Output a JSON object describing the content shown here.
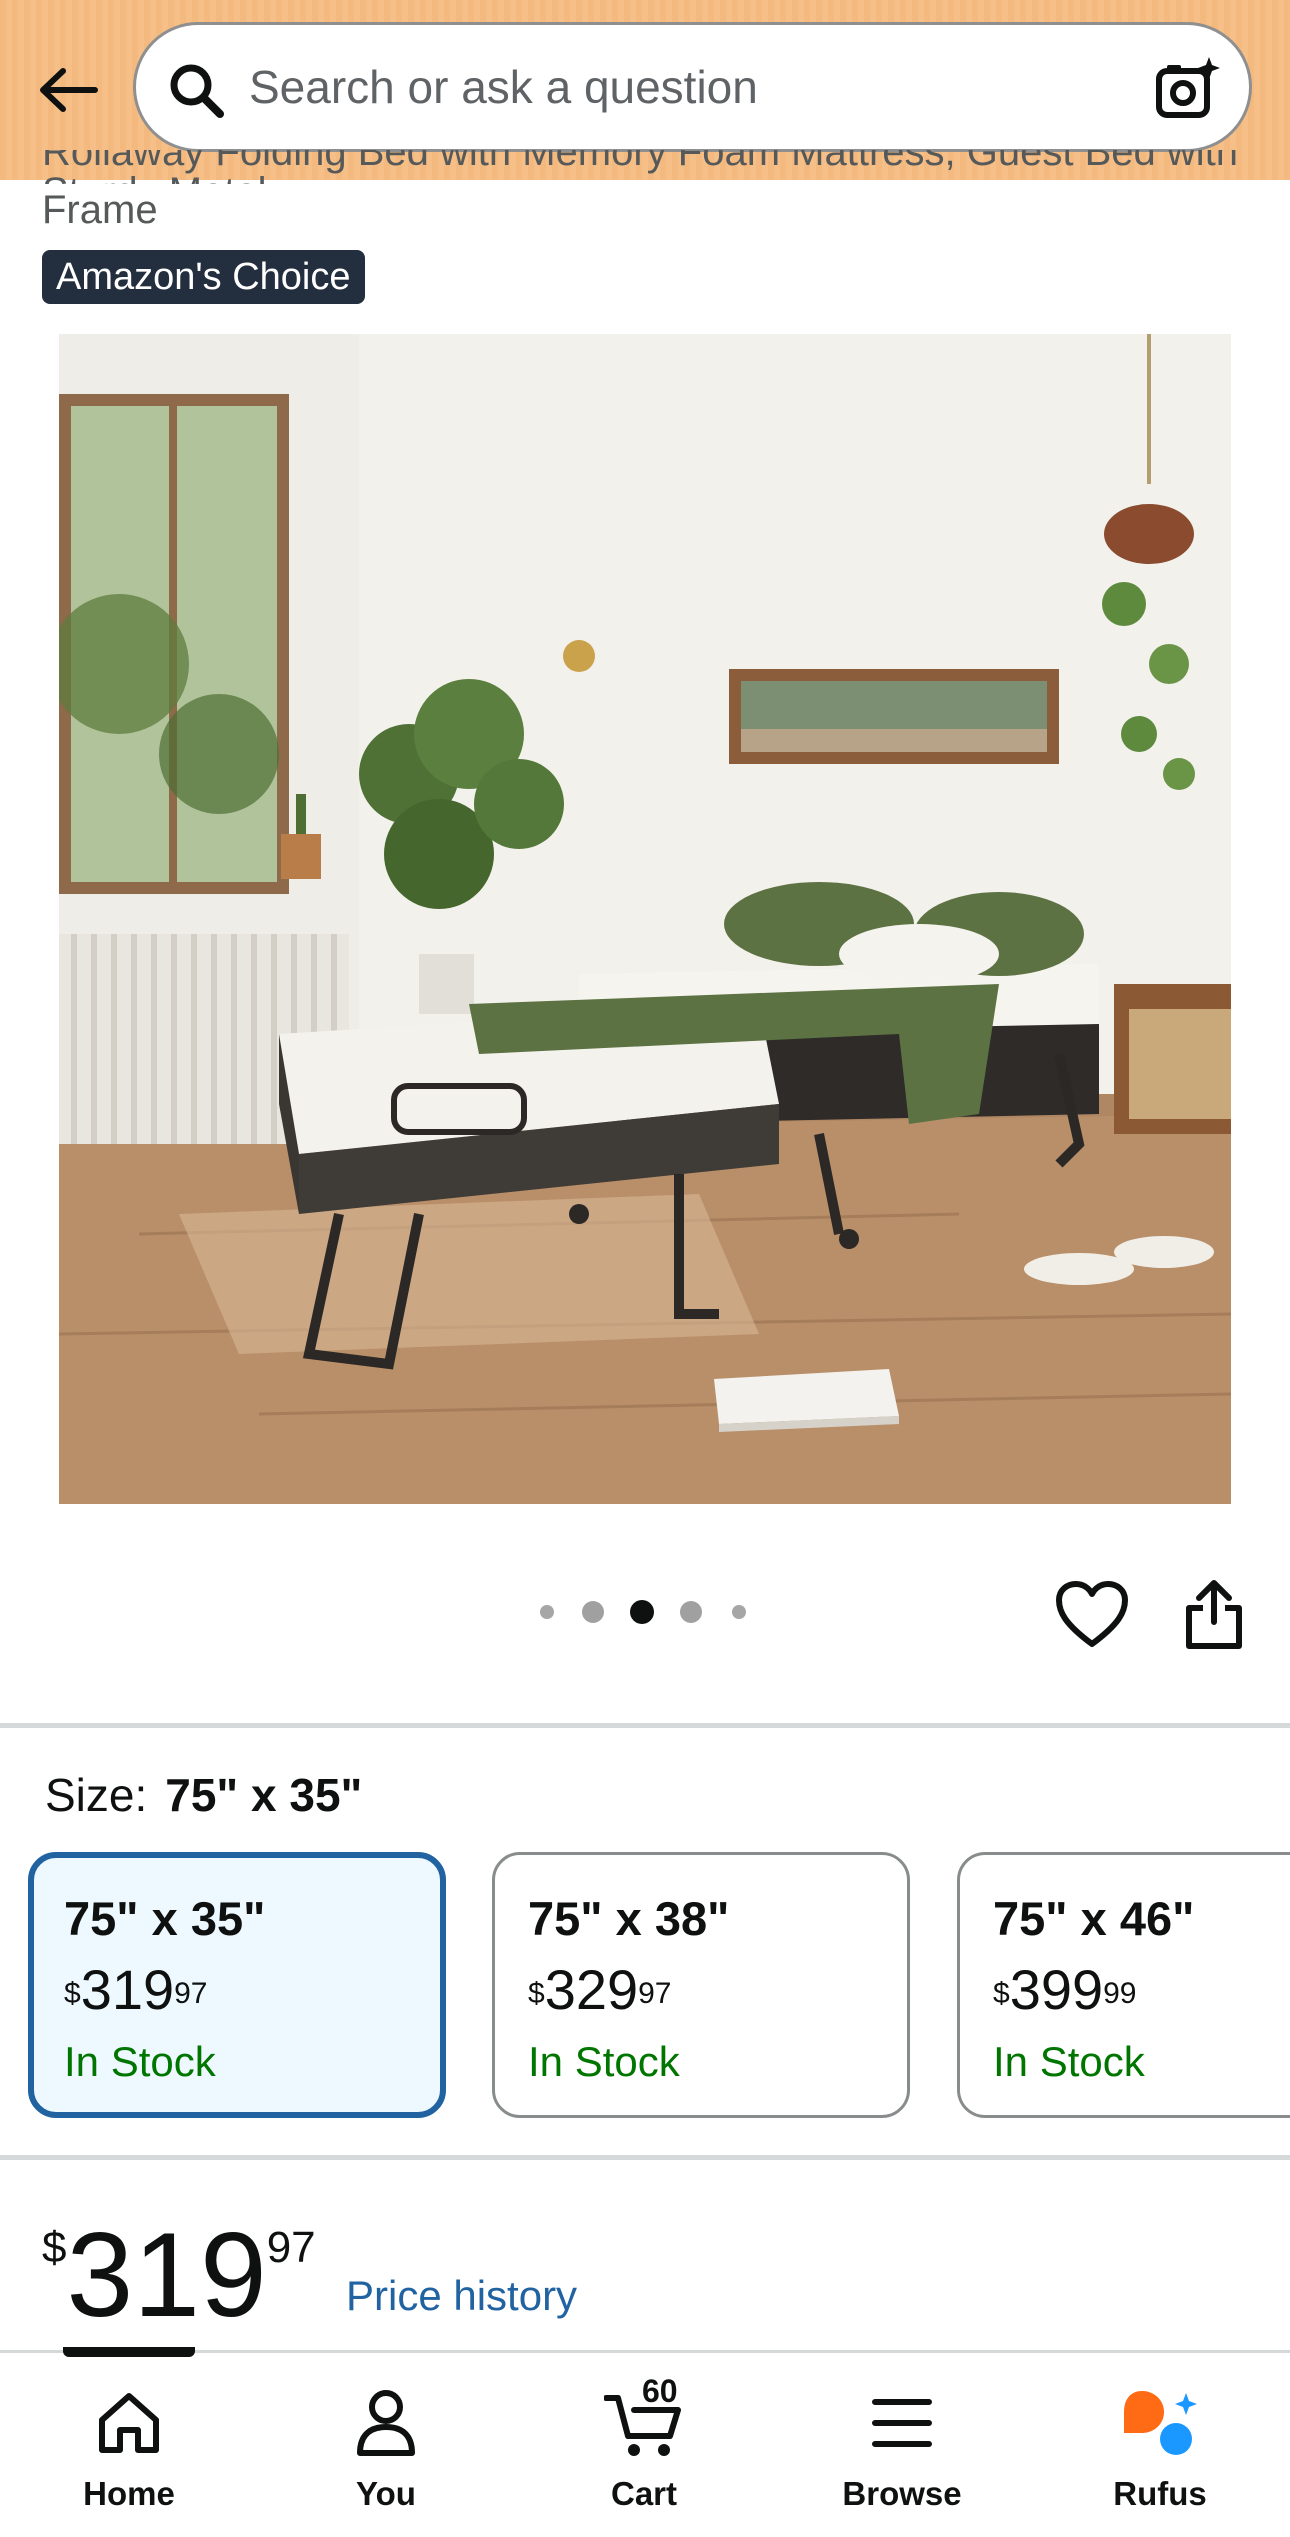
{
  "header": {
    "search_placeholder": "Search or ask a question",
    "icons": [
      "back-arrow-icon",
      "search-icon",
      "camera-sparkle-icon"
    ],
    "background_color": "#f4b97f"
  },
  "product": {
    "title_cut_text": "Rollaway Folding Bed with Memory Foam Mattress, Guest Bed with Sturdy Metal",
    "title_end": "Frame",
    "badge": "Amazon's Choice",
    "image_index": 3,
    "image_count": 5
  },
  "size": {
    "label": "Size:",
    "selected": "75\" x 35\"",
    "options": [
      {
        "title": "75\" x 35\"",
        "symbol": "$",
        "whole": "319",
        "cents": "97",
        "stock": "In Stock"
      },
      {
        "title": "75\" x 38\"",
        "symbol": "$",
        "whole": "329",
        "cents": "97",
        "stock": "In Stock"
      },
      {
        "title": "75\" x 46\"",
        "symbol": "$",
        "whole": "399",
        "cents": "99",
        "stock": "In Stock"
      }
    ]
  },
  "price": {
    "symbol": "$",
    "whole": "319",
    "cents": "97",
    "history_link": "Price history"
  },
  "nav": {
    "items": [
      {
        "label": "Home",
        "icon": "home-icon"
      },
      {
        "label": "You",
        "icon": "person-icon"
      },
      {
        "label": "Cart",
        "icon": "cart-icon"
      },
      {
        "label": "Browse",
        "icon": "menu-icon"
      },
      {
        "label": "Rufus",
        "icon": "rufus-icon"
      }
    ],
    "cart_count": "60"
  },
  "colors": {
    "accent_link": "#2162a1",
    "in_stock": "#007600",
    "selected_border": "#2162a1",
    "rufus_orange": "#ff6a14",
    "rufus_blue": "#1a98ff"
  }
}
